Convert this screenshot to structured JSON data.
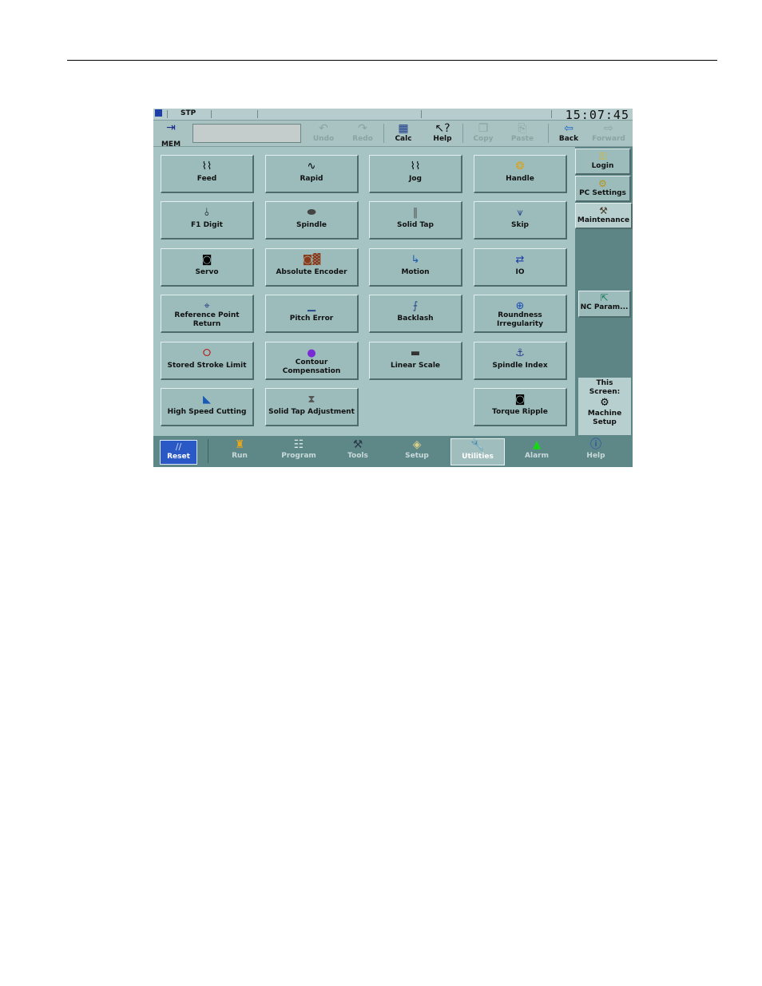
{
  "status_bar": {
    "mode": "STP",
    "clock": "15:07:45"
  },
  "toolbar": {
    "mem_label": "MEM",
    "undo": "Undo",
    "redo": "Redo",
    "calc": "Calc",
    "help": "Help",
    "copy": "Copy",
    "paste": "Paste",
    "back": "Back",
    "forward": "Forward"
  },
  "grid": {
    "feed": "Feed",
    "rapid": "Rapid",
    "jog": "Jog",
    "handle": "Handle",
    "f1_digit": "F1 Digit",
    "spindle": "Spindle",
    "solid_tap": "Solid Tap",
    "skip": "Skip",
    "servo": "Servo",
    "absolute_encoder": "Absolute Encoder",
    "motion": "Motion",
    "io": "IO",
    "reference_point_return_1": "Reference Point",
    "reference_point_return_2": "Return",
    "pitch_error": "Pitch Error",
    "backlash": "Backlash",
    "roundness_1": "Roundness",
    "roundness_2": "Irregularity",
    "stored_stroke_limit": "Stored Stroke Limit",
    "contour_1": "Contour",
    "contour_2": "Compensation",
    "linear_scale": "Linear Scale",
    "spindle_index": "Spindle Index",
    "high_speed_cutting": "High Speed Cutting",
    "solid_tap_adjustment": "Solid Tap Adjustment",
    "torque_ripple": "Torque Ripple"
  },
  "sidebar": {
    "login": "Login",
    "pc_settings": "PC Settings",
    "maintenance": "Maintenance",
    "nc_param": "NC Param...",
    "this_screen_1": "This",
    "this_screen_2": "Screen:",
    "this_screen_3": "Machine",
    "this_screen_4": "Setup"
  },
  "bottom_nav": {
    "reset": "Reset",
    "run": "Run",
    "program": "Program",
    "tools": "Tools",
    "setup": "Setup",
    "utilities": "Utilities",
    "alarm": "Alarm",
    "help": "Help"
  }
}
